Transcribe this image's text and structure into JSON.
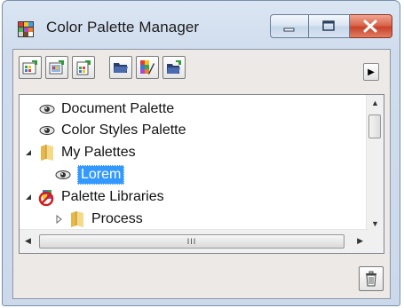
{
  "window": {
    "title": "Color Palette Manager",
    "icon": "palette-manager-app-icon",
    "caption_buttons": [
      "minimize-icon",
      "maximize-icon",
      "close-icon"
    ]
  },
  "toolbar": {
    "buttons": [
      {
        "name": "new-palette-icon"
      },
      {
        "name": "new-palette-from-selection-icon"
      },
      {
        "name": "new-palette-from-document-icon"
      },
      {
        "name": "open-palette-icon"
      },
      {
        "name": "palette-editor-icon"
      },
      {
        "name": "save-palette-icon"
      }
    ],
    "flyout": "flyout-arrow-icon"
  },
  "tree": {
    "items": [
      {
        "label": "Document Palette",
        "icon": "eye-icon",
        "level": 0,
        "expander": "none"
      },
      {
        "label": "Color Styles Palette",
        "icon": "eye-icon",
        "level": 0,
        "expander": "none"
      },
      {
        "label": "My Palettes",
        "icon": "folder-icon",
        "level": 0,
        "expander": "expanded"
      },
      {
        "label": "Lorem",
        "icon": "eye-icon",
        "level": 1,
        "expander": "none",
        "selected": true
      },
      {
        "label": "Palette Libraries",
        "icon": "palette-library-icon",
        "level": 0,
        "expander": "expanded"
      },
      {
        "label": "Process",
        "icon": "folder-icon",
        "level": 1,
        "expander": "collapsed"
      }
    ],
    "hscroll_grip": "III"
  },
  "footer": {
    "delete": "trash-icon"
  },
  "colors": {
    "selection": "#3399ff",
    "close_button": "#c8432a"
  }
}
